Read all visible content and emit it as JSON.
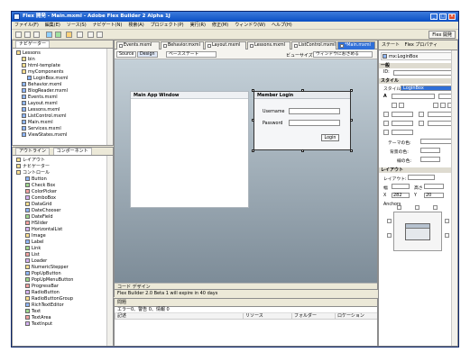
{
  "window": {
    "title": "Flex 開発 - Main.mxml - Adobe Flex Builder 2 Alpha 1J"
  },
  "menu": [
    "ファイル(F)",
    "編集(E)",
    "ソース(S)",
    "ナビゲート(N)",
    "検索(A)",
    "プロジェクト(P)",
    "実行(R)",
    "修正(M)",
    "ウィンドウ(W)",
    "ヘルプ(H)"
  ],
  "toolbar": {
    "perspective": "Flex 開発"
  },
  "navigator": {
    "tab": "ナビゲーター",
    "items": [
      {
        "label": "Lessons",
        "indent": 0,
        "icon": "folder-icon"
      },
      {
        "label": "bin",
        "indent": 1,
        "icon": "folder-icon"
      },
      {
        "label": "html-template",
        "indent": 1,
        "icon": "folder-icon"
      },
      {
        "label": "myComponents",
        "indent": 1,
        "icon": "folder-icon"
      },
      {
        "label": "LoginBox.mxml",
        "indent": 2,
        "icon": "mxml-file-icon"
      },
      {
        "label": "Behavior.mxml",
        "indent": 1,
        "icon": "mxml-file-icon"
      },
      {
        "label": "BlogReader.mxml",
        "indent": 1,
        "icon": "mxml-file-icon"
      },
      {
        "label": "Events.mxml",
        "indent": 1,
        "icon": "mxml-file-icon"
      },
      {
        "label": "Layout.mxml",
        "indent": 1,
        "icon": "mxml-file-icon"
      },
      {
        "label": "Lessons.mxml",
        "indent": 1,
        "icon": "mxml-file-icon"
      },
      {
        "label": "ListControl.mxml",
        "indent": 1,
        "icon": "mxml-file-icon"
      },
      {
        "label": "Main.mxml",
        "indent": 1,
        "icon": "mxml-file-icon"
      },
      {
        "label": "Services.mxml",
        "indent": 1,
        "icon": "mxml-file-icon"
      },
      {
        "label": "ViewStates.mxml",
        "indent": 1,
        "icon": "mxml-file-icon"
      }
    ]
  },
  "components": {
    "tabs": [
      "アウトライン",
      "コンポーネント"
    ],
    "sections": [
      {
        "label": "レイアウト"
      },
      {
        "label": "ナビゲーター"
      },
      {
        "label": "コントロール"
      }
    ],
    "items": [
      "Button",
      "Check Box",
      "ColorPicker",
      "ComboBox",
      "DataGrid",
      "DateChooser",
      "DateField",
      "HSlider",
      "HorizontalList",
      "Image",
      "Label",
      "Link",
      "List",
      "Loader",
      "NumericStepper",
      "PopUpButton",
      "PopUpMenuButton",
      "ProgressBar",
      "RadioButton",
      "RadioButtonGroup",
      "RichTextEditor",
      "Text",
      "TextArea",
      "TextInput"
    ]
  },
  "editor": {
    "tabs": [
      "Events.mxml",
      "Behavior.mxml",
      "Layout.mxml",
      "Lessons.mxml",
      "ListControl.mxml",
      "*Main.mxml"
    ],
    "active_tab": "*Main.mxml",
    "source_label": "Source",
    "design_label": "Design",
    "state_select": "ベースステート",
    "preview_label": "ビューサイズ:",
    "preview_value": "ウィンドウにおさめる",
    "main_window_title": "Main App Window",
    "login": {
      "title": "Member Login",
      "username": "Username",
      "password": "Password",
      "button": "Login"
    },
    "footer_tabs": "コード デザイン",
    "status": "Flex Builder 2.0 Beta 1 will expire in 40 days"
  },
  "problems": {
    "tab": "問題",
    "summary": "エラー0、警告 0、情報 0",
    "columns": [
      "記述",
      "リソース",
      "フォルダー",
      "ロケーション"
    ]
  },
  "inspector": {
    "tabs": [
      "ステート",
      "Flex プロパティ"
    ],
    "component": "mx:LoginBox",
    "section_general": "一般",
    "id_label": "ID:",
    "id_value": "",
    "section_style": "スタイル",
    "style_label": "スタイル",
    "style_value": "LoginBox",
    "font_label": "A",
    "theme_label": "テーマの色:",
    "bg_label": "背景の色:",
    "border_label": "線の色:",
    "section_layout": "レイアウト",
    "layout_label": "レイアウト:",
    "width_label": "幅",
    "width_value": "",
    "height_label": "高さ",
    "height_value": "",
    "x_label": "X",
    "x_value": "282",
    "y_label": "Y",
    "y_value": "20",
    "anchors_label": "Anchors"
  }
}
